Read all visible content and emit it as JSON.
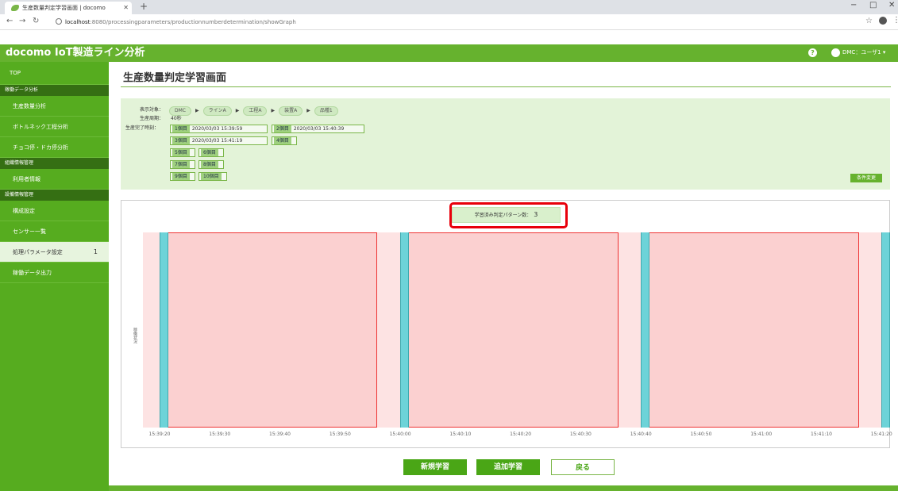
{
  "browser": {
    "tab_title": "生産数量判定学習画面 | docomo",
    "url_host": "localhost",
    "url_path": ":8080/processingparameters/productionnumberdetermination/showGraph",
    "window_controls": [
      "−",
      "□",
      "✕"
    ]
  },
  "header": {
    "app_name": "docomo IoT製造ライン分析",
    "help": "?",
    "user": "DMC：ユーザ1 ▾"
  },
  "sidebar": {
    "top": "TOP",
    "sec1": "稼働データ分析",
    "items1": [
      "生産数量分析",
      "ボトルネック工程分析",
      "チョコ停・ドカ停分析"
    ],
    "sec2": "組織情報管理",
    "items2": [
      "利用者情報"
    ],
    "sec3": "設備情報管理",
    "items3": [
      "構成設定",
      "センサー一覧",
      "処理パラメータ設定"
    ],
    "active_badge": "1",
    "items4": [
      "稼働データ出力"
    ]
  },
  "page": {
    "title": "生産数量判定学習画面"
  },
  "conditions": {
    "target_label": "表示対象：",
    "crumbs": [
      "DMC",
      "ラインA",
      "工程A",
      "装置A",
      "品種1"
    ],
    "cycle_label": "生産周期：",
    "cycle_value": "40秒",
    "done_label": "生産完了時刻：",
    "runs": [
      {
        "n": "1個目",
        "t": "2020/03/03 15:39:59"
      },
      {
        "n": "2個目",
        "t": "2020/03/03 15:40:39"
      },
      {
        "n": "3個目",
        "t": "2020/03/03 15:41:19"
      },
      {
        "n": "4個目",
        "t": ""
      },
      {
        "n": "5個目",
        "t": ""
      },
      {
        "n": "6個目",
        "t": ""
      },
      {
        "n": "7個目",
        "t": ""
      },
      {
        "n": "8個目",
        "t": ""
      },
      {
        "n": "9個目",
        "t": ""
      },
      {
        "n": "10個目",
        "t": ""
      }
    ],
    "change_button": "条件変更"
  },
  "chart": {
    "pattern_label": "学習済み判定パターン数：",
    "pattern_count": "3",
    "ylabel": "稼働状況",
    "xticks": [
      "15:39:20",
      "15:39:30",
      "15:39:40",
      "15:39:50",
      "15:40:00",
      "15:40:10",
      "15:40:20",
      "15:40:30",
      "15:40:40",
      "15:40:50",
      "15:41:00",
      "15:41:10",
      "15:41:20"
    ]
  },
  "chart_data": {
    "type": "area",
    "title": "",
    "xlabel": "",
    "ylabel": "稼働状況",
    "x_range": [
      "15:39:20",
      "15:41:23"
    ],
    "series": [
      {
        "values": [
          {
            "start": "15:39:23",
            "end": "15:39:59"
          },
          {
            "start": "15:40:03",
            "end": "15:40:39"
          },
          {
            "start": "15:40:43",
            "end": "15:41:19"
          }
        ]
      }
    ],
    "markers": [
      "15:39:20",
      "15:40:00",
      "15:40:40",
      "15:41:20"
    ],
    "colors": {
      "segment": "#fbd0d0",
      "background": "#fde3e3",
      "marker": "#6dd3d8",
      "border": "#e33333"
    }
  },
  "footer": {
    "new_learn": "新規学習",
    "add_learn": "追加学習",
    "back": "戻る"
  }
}
